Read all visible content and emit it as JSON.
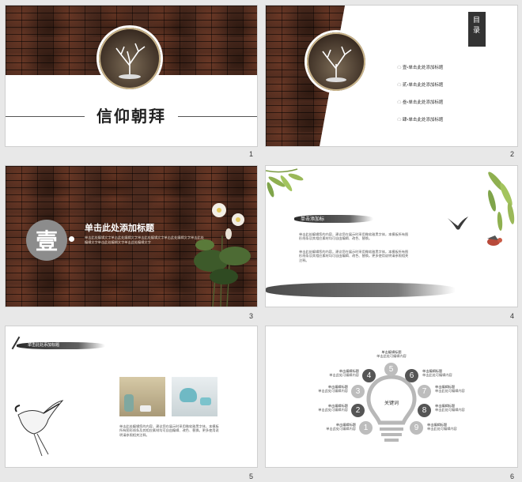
{
  "slides": [
    {
      "number": "1",
      "title": "信仰朝拜"
    },
    {
      "number": "2",
      "toc_title": "目录",
      "items": [
        {
          "label": "壹•单击此处添加标题"
        },
        {
          "label": "贰•单击此处添加标题"
        },
        {
          "label": "叁•单击此处添加标题"
        },
        {
          "label": "肆•单击此处添加标题"
        }
      ]
    },
    {
      "number": "3",
      "badge": "壹",
      "heading": "单击此处添加标题",
      "body": "单击此处编辑文字单击此处编辑文字单击此处编辑文字单击此处编辑文字单击此处编辑文字单击此处编辑文字单击此处编辑文字"
    },
    {
      "number": "4",
      "tag": "单击添加标",
      "para1": "单击此处编辑您的内容，建议您在展示时采用微软雅黑字体，本模板所有图形线条及其相应素材均可自由编辑、改色、替换。",
      "para2": "单击此处编辑您的内容，建议您在展示时采用微软雅黑字体，本模板所有图形线条及其相应素材均可自由编辑、改色、替换。更多使用说明请参照相关注释。"
    },
    {
      "number": "5",
      "tag": "单击此处添加标题",
      "body": "单击此处编辑您的内容，建议您在展示时采用微软雅黑字体，本模板所有图形线条及其相应素材均可自由编辑、改色、替换。更多使用说明请参照相关注释。"
    },
    {
      "number": "6",
      "center": "关键词",
      "nodes": [
        {
          "n": "1",
          "title": "单击编辑标题",
          "sub": "单击此处可编辑内容"
        },
        {
          "n": "2",
          "title": "单击编辑标题",
          "sub": "单击此处可编辑内容"
        },
        {
          "n": "3",
          "title": "单击编辑标题",
          "sub": "单击此处可编辑内容"
        },
        {
          "n": "4",
          "title": "单击编辑标题",
          "sub": "单击此处可编辑内容"
        },
        {
          "n": "5",
          "title": "单击编辑标题",
          "sub": "单击此处可编辑内容"
        },
        {
          "n": "6",
          "title": "单击编辑标题",
          "sub": "单击此处可编辑内容"
        },
        {
          "n": "7",
          "title": "单击编辑标题",
          "sub": "单击此处可编辑内容"
        },
        {
          "n": "8",
          "title": "单击编辑标题",
          "sub": "单击此处可编辑内容"
        },
        {
          "n": "9",
          "title": "单击编辑标题",
          "sub": "单击此处可编辑内容"
        }
      ]
    }
  ]
}
